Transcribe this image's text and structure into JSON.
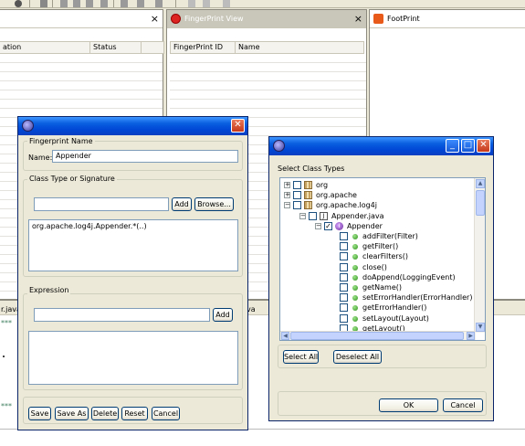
{
  "workbench": {
    "left_col_operation_fragment": "ation",
    "left_col_status": "Status",
    "fingerprint_view_title": "FingerPrint View",
    "fingerprint_col_id": "FingerPrint ID",
    "fingerprint_col_name": "Name",
    "footprint_title": "FootPrint",
    "close_glyph": "×",
    "editor_tab_fragment_left": "r.java",
    "editor_tab_fragment_right": "va",
    "stars_1": "***",
    "stars_2": "***"
  },
  "fingerprint_dialog": {
    "name_group": "Fingerprint Name",
    "name_label": "Name:",
    "name_value": "Appender",
    "class_group": "Class Type or Signature",
    "class_input_value": "",
    "add_label": "Add",
    "browse_label": "Browse...",
    "signature_entry": "org.apache.log4j.Appender.*(..)",
    "expression_group": "Expression",
    "expression_input_value": "",
    "expression_add_label": "Add",
    "buttons": {
      "save": "Save",
      "save_as": "Save As",
      "delete": "Delete",
      "reset": "Reset",
      "cancel": "Cancel"
    }
  },
  "class_dialog": {
    "heading": "Select Class Types",
    "tree": [
      {
        "label": "org",
        "level": 0,
        "toggle": "+",
        "checked": false,
        "icon": "package-icon"
      },
      {
        "label": "org.apache",
        "level": 0,
        "toggle": "+",
        "checked": false,
        "icon": "package-icon"
      },
      {
        "label": "org.apache.log4j",
        "level": 0,
        "toggle": "−",
        "checked": false,
        "icon": "package-icon"
      },
      {
        "label": "Appender.java",
        "level": 1,
        "toggle": "−",
        "checked": false,
        "icon": "java-file-icon"
      },
      {
        "label": "Appender",
        "level": 2,
        "toggle": "−",
        "checked": true,
        "icon": "interface-icon"
      },
      {
        "label": "addFilter(Filter)",
        "level": 3,
        "checked": false,
        "icon": "method-icon"
      },
      {
        "label": "getFilter()",
        "level": 3,
        "checked": false,
        "icon": "method-icon"
      },
      {
        "label": "clearFilters()",
        "level": 3,
        "checked": false,
        "icon": "method-icon"
      },
      {
        "label": "close()",
        "level": 3,
        "checked": false,
        "icon": "method-icon"
      },
      {
        "label": "doAppend(LoggingEvent)",
        "level": 3,
        "checked": false,
        "icon": "method-icon"
      },
      {
        "label": "getName()",
        "level": 3,
        "checked": false,
        "icon": "method-icon"
      },
      {
        "label": "setErrorHandler(ErrorHandler)",
        "level": 3,
        "checked": false,
        "icon": "method-icon"
      },
      {
        "label": "getErrorHandler()",
        "level": 3,
        "checked": false,
        "icon": "method-icon"
      },
      {
        "label": "setLayout(Layout)",
        "level": 3,
        "checked": false,
        "icon": "method-icon"
      },
      {
        "label": "getLayout()",
        "level": 3,
        "checked": false,
        "icon": "method-icon"
      }
    ],
    "select_all": "Select All",
    "deselect_all": "Deselect All",
    "ok": "OK",
    "cancel": "Cancel",
    "minimize_glyph": "_",
    "maximize_glyph": "□",
    "close_glyph": "✕"
  },
  "colors": {
    "titlebar": "#0046d5",
    "dialog_bg": "#ece9d8",
    "method_icon": "#2f8f1e"
  }
}
